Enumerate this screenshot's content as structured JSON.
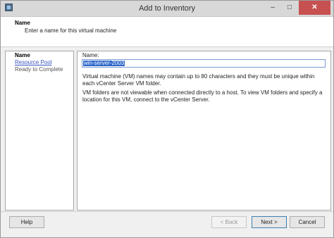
{
  "window": {
    "title": "Add to Inventory",
    "controls": {
      "minimize": "–",
      "maximize": "□",
      "close": "✕"
    }
  },
  "header": {
    "title": "Name",
    "subtitle": "Enter a name for this virtual machine"
  },
  "steps": [
    {
      "label": "Name",
      "state": "current"
    },
    {
      "label": "Resource Pool",
      "state": "link"
    },
    {
      "label": "Ready to Complete",
      "state": "pending"
    }
  ],
  "form": {
    "name_label": "Name:",
    "name_value": "win-server-2003",
    "info_text": "Virtual machine (VM) names may contain up to 80 characters and they must be unique within each vCenter Server VM folder.",
    "note_text": "VM folders are not viewable when connected directly to a host. To view VM folders and specify a location for this VM, connect to the vCenter Server."
  },
  "buttons": {
    "help": "Help",
    "back": "< Back",
    "next": "Next >",
    "cancel": "Cancel"
  },
  "colors": {
    "selection": "#2d67c9",
    "link": "#3a56c4",
    "close_button": "#c75050"
  }
}
